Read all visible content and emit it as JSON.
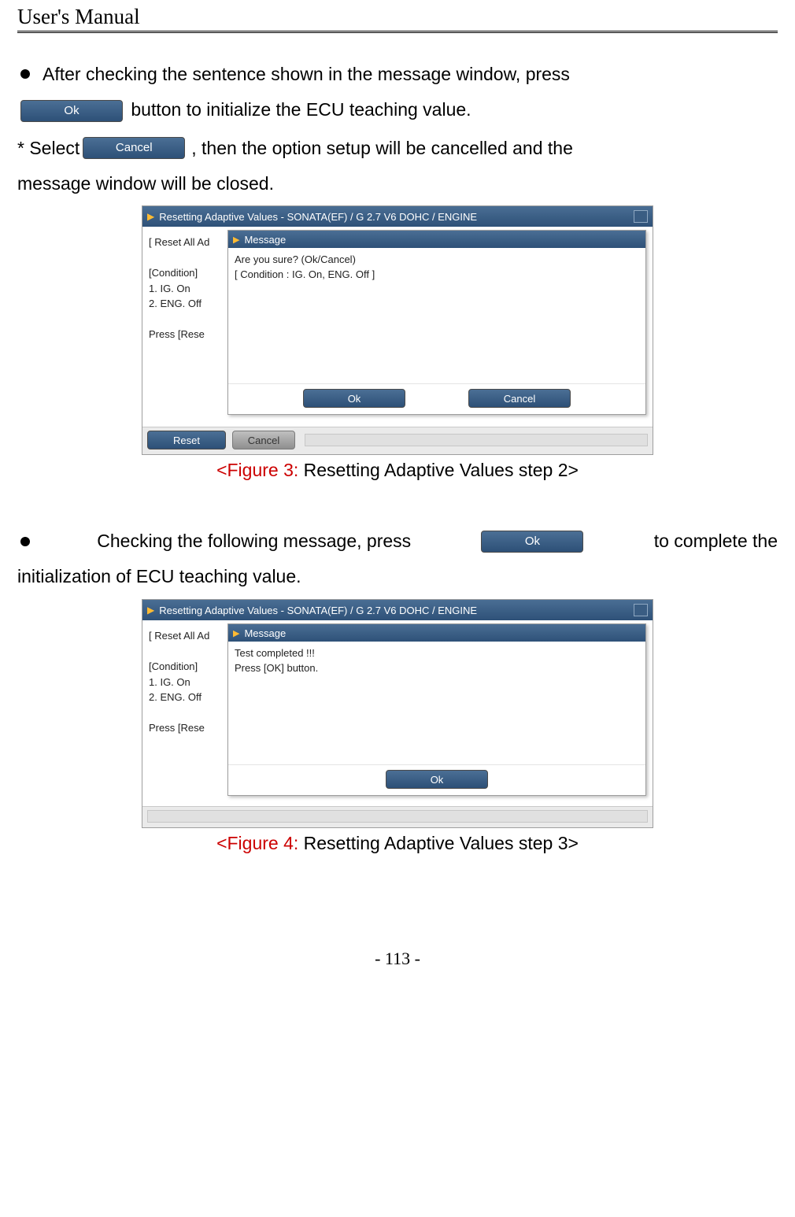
{
  "header": {
    "title": "User's Manual"
  },
  "para1": {
    "lead": "After checking the sentence shown in the message window, press",
    "ok_label": "Ok",
    "tail": " button to initialize the ECU teaching value."
  },
  "para2": {
    "lead": "* Select ",
    "cancel_label": "Cancel",
    "mid": ", then the option setup will be cancelled and the",
    "tail": "message window will be closed."
  },
  "fig3": {
    "window_title": "Resetting Adaptive Values - SONATA(EF) / G 2.7 V6 DOHC / ENGINE",
    "left_lines": [
      "[ Reset All Ad",
      "",
      "[Condition]",
      "  1. IG. On",
      "  2. ENG. Off",
      "",
      "Press [Rese"
    ],
    "dialog_title": "Message",
    "dialog_lines": [
      "Are you sure? (Ok/Cancel)",
      "[ Condition : IG. On, ENG. Off ]"
    ],
    "dialog_ok": "Ok",
    "dialog_cancel": "Cancel",
    "footer_reset": "Reset",
    "footer_cancel": "Cancel",
    "caption_tag": "<Figure 3:",
    "caption_rest": " Resetting Adaptive Values step 2>"
  },
  "para3": {
    "lead": "Checking the following message, press ",
    "ok_label": "Ok",
    "tail": " to complete the",
    "line2": "initialization of ECU teaching value."
  },
  "fig4": {
    "window_title": "Resetting Adaptive Values - SONATA(EF) / G 2.7 V6 DOHC / ENGINE",
    "left_lines": [
      "[ Reset All Ad",
      "",
      "[Condition]",
      "  1. IG. On",
      "  2. ENG. Off",
      "",
      "Press [Rese"
    ],
    "dialog_title": "Message",
    "dialog_lines": [
      "Test completed !!!",
      "Press [OK] button."
    ],
    "dialog_ok": "Ok",
    "caption_tag": "<Figure 4:",
    "caption_rest": " Resetting Adaptive Values step 3>"
  },
  "footer": {
    "page_number": "- 113 -"
  }
}
